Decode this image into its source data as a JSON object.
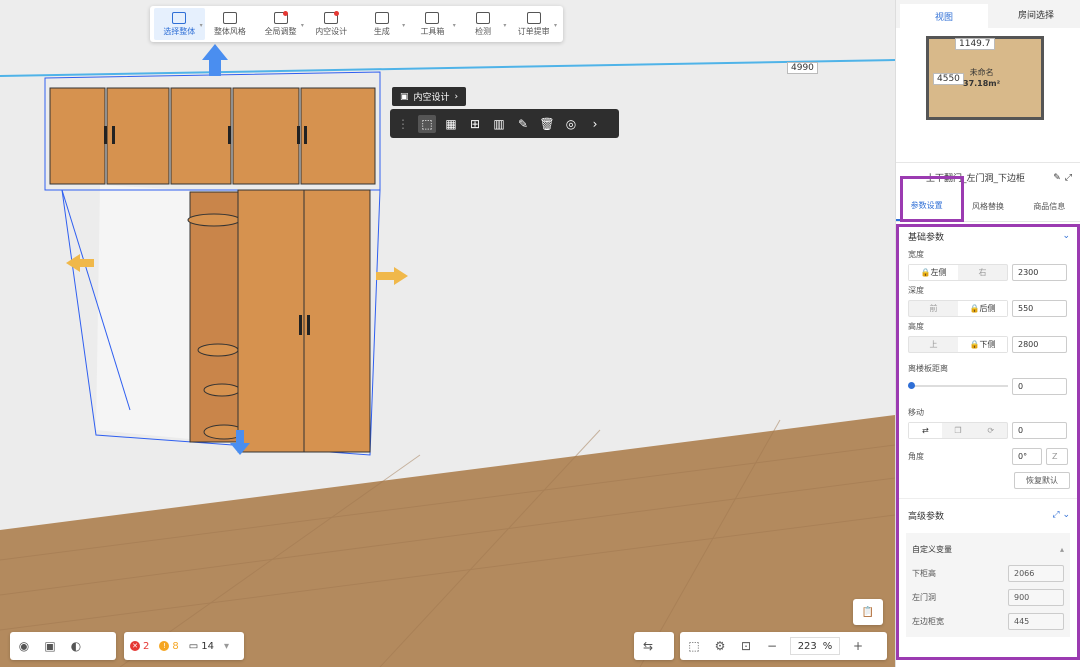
{
  "toolbar": {
    "items": [
      {
        "label": "选择整体",
        "icon": "select-whole-icon",
        "active": true
      },
      {
        "label": "整体风格",
        "icon": "paint-roller-icon"
      },
      {
        "label": "全局调整",
        "icon": "palette-icon"
      },
      {
        "label": "内空设计",
        "icon": "interior-frame-icon"
      },
      {
        "label": "生成",
        "icon": "generate-icon"
      },
      {
        "label": "工具箱",
        "icon": "puzzle-icon"
      },
      {
        "label": "检测",
        "icon": "target-icon"
      },
      {
        "label": "订单提审",
        "icon": "clipboard-icon"
      }
    ]
  },
  "viewport": {
    "dimension_top": "4990",
    "interior_design_tag": "内空设计",
    "float_tools": [
      "select-icon",
      "box-select-icon",
      "add-board-icon",
      "split-icon",
      "edit-icon",
      "trash-icon",
      "3d-icon"
    ]
  },
  "bottom_left": {
    "errors": "2",
    "warnings": "8",
    "files": "14"
  },
  "bottom_right": {
    "zoom": "223",
    "zoom_unit": "%"
  },
  "minimap": {
    "tabs": [
      "视图",
      "房间选择"
    ],
    "width_label": "1149.7",
    "height_label": "4550",
    "room_name": "未命名",
    "room_area": "37.18m²"
  },
  "panel": {
    "title": "上下翻门_左门洞_下边柜",
    "tabs": [
      "参数设置",
      "风格替换",
      "商品信息"
    ],
    "basic_title": "基础参数",
    "width_label": "宽度",
    "width_seg": [
      "左侧",
      "右"
    ],
    "width_value": "2300",
    "depth_label": "深度",
    "depth_seg": [
      "前",
      "后侧"
    ],
    "depth_value": "550",
    "height_label": "高度",
    "height_seg": [
      "上",
      "下侧"
    ],
    "height_value": "2800",
    "floor_dist_label": "离楼板距离",
    "floor_dist_value": "0",
    "move_label": "移动",
    "move_value": "0",
    "angle_label": "角度",
    "angle_value": "0°",
    "angle_axis": "Z",
    "reset_label": "恢复默认",
    "advanced_title": "高级参数",
    "custom_vars_title": "自定义变量",
    "vars": [
      {
        "label": "下柜高",
        "value": "2066"
      },
      {
        "label": "左门洞",
        "value": "900"
      },
      {
        "label": "左边柜宽",
        "value": "445"
      }
    ]
  }
}
